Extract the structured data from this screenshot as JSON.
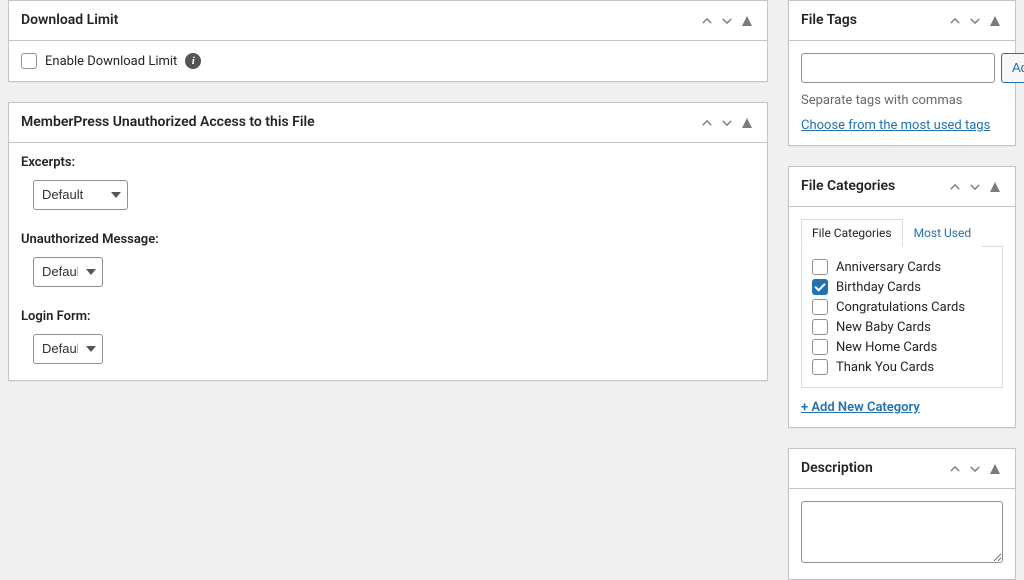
{
  "main": {
    "download_limit": {
      "title": "Download Limit",
      "checkbox_label": "Enable Download Limit",
      "checked": false
    },
    "unauthorized": {
      "title": "MemberPress Unauthorized Access to this File",
      "fields": {
        "excerpts": {
          "label": "Excerpts:",
          "value": "Default"
        },
        "message": {
          "label": "Unauthorized Message:",
          "value": "Default"
        },
        "login_form": {
          "label": "Login Form:",
          "value": "Default"
        }
      }
    }
  },
  "side": {
    "tags": {
      "title": "File Tags",
      "add_button": "Add",
      "howto": "Separate tags with commas",
      "choose_link": "Choose from the most used tags",
      "input_value": ""
    },
    "categories": {
      "title": "File Categories",
      "tabs": {
        "all": "File Categories",
        "most": "Most Used"
      },
      "items": [
        {
          "label": "Anniversary Cards",
          "checked": false
        },
        {
          "label": "Birthday Cards",
          "checked": true
        },
        {
          "label": "Congratulations Cards",
          "checked": false
        },
        {
          "label": "New Baby Cards",
          "checked": false
        },
        {
          "label": "New Home Cards",
          "checked": false
        },
        {
          "label": "Thank You Cards",
          "checked": false
        }
      ],
      "add_new": "+ Add New Category"
    },
    "description": {
      "title": "Description",
      "value": ""
    }
  }
}
